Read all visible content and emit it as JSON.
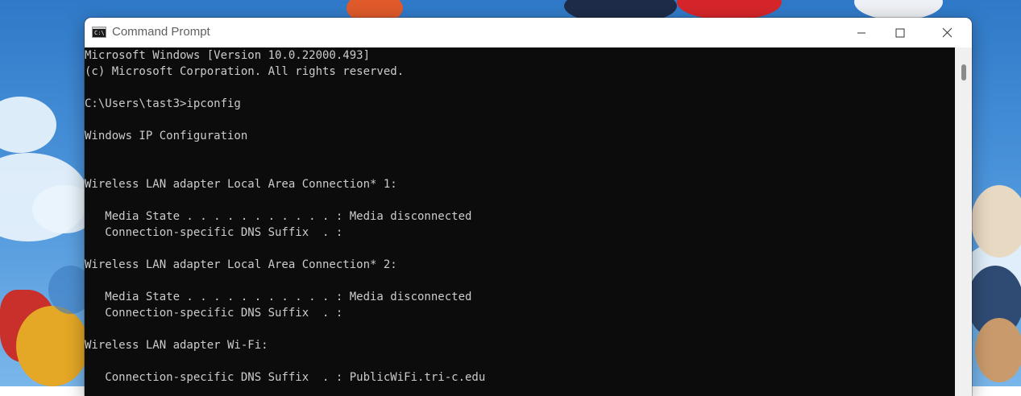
{
  "window": {
    "title": "Command Prompt",
    "icon": "cmd-icon",
    "icon_glyph": "C:\\",
    "controls": [
      "minimize-icon",
      "maximize-icon",
      "close-icon"
    ]
  },
  "console": {
    "lines": [
      "Microsoft Windows [Version 10.0.22000.493]",
      "(c) Microsoft Corporation. All rights reserved.",
      "",
      "C:\\Users\\tast3>ipconfig",
      "",
      "Windows IP Configuration",
      "",
      "",
      "Wireless LAN adapter Local Area Connection* 1:",
      "",
      "   Media State . . . . . . . . . . . : Media disconnected",
      "   Connection-specific DNS Suffix  . :",
      "",
      "Wireless LAN adapter Local Area Connection* 2:",
      "",
      "   Media State . . . . . . . . . . . : Media disconnected",
      "   Connection-specific DNS Suffix  . :",
      "",
      "Wireless LAN adapter Wi-Fi:",
      "",
      "   Connection-specific DNS Suffix  . : PublicWiFi.tri-c.edu"
    ]
  },
  "colors": {
    "console_bg": "#0c0c0c",
    "console_text": "#cccccc",
    "titlebar_bg": "#ffffff",
    "desktop_sky": "#4a93da"
  }
}
